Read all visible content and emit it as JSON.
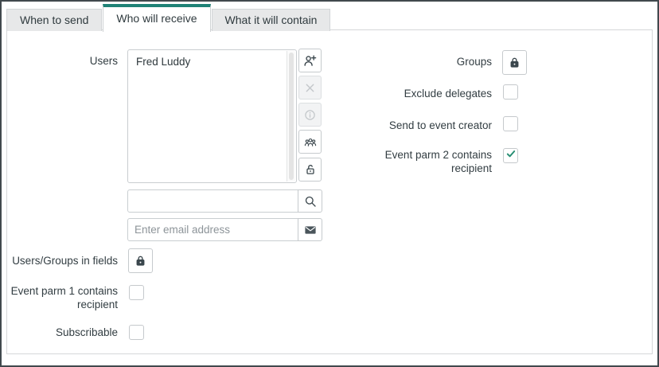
{
  "tabs": [
    {
      "label": "When to send",
      "active": false
    },
    {
      "label": "Who will receive",
      "active": true
    },
    {
      "label": "What it will contain",
      "active": false
    }
  ],
  "left": {
    "users_label": "Users",
    "users_list": [
      "Fred Luddy"
    ],
    "list_buttons": [
      {
        "name": "add-user",
        "enabled": true
      },
      {
        "name": "remove-user",
        "enabled": false
      },
      {
        "name": "user-info",
        "enabled": false
      },
      {
        "name": "user-group",
        "enabled": true
      },
      {
        "name": "lock",
        "enabled": true
      }
    ],
    "search": {
      "value": "",
      "placeholder": ""
    },
    "email": {
      "value": "",
      "placeholder": "Enter email address"
    },
    "users_groups_in_fields_label": "Users/Groups in fields",
    "event_parm_1_label": "Event parm 1 contains recipient",
    "event_parm_1_checked": false,
    "subscribable_label": "Subscribable",
    "subscribable_checked": false
  },
  "right": {
    "groups_label": "Groups",
    "exclude_delegates_label": "Exclude delegates",
    "exclude_delegates_checked": false,
    "send_to_event_creator_label": "Send to event creator",
    "send_to_event_creator_checked": false,
    "event_parm_2_label": "Event parm 2 contains recipient",
    "event_parm_2_checked": true
  },
  "colors": {
    "accent_teal": "#1f8276",
    "check_teal": "#278e73",
    "icon_dark": "#3a464c"
  }
}
